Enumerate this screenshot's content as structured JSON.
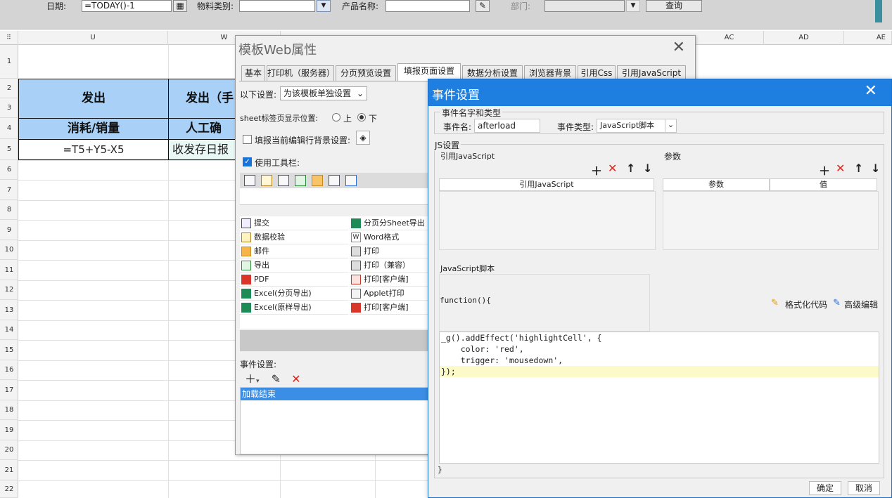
{
  "filter_bar": {
    "date_label": "日期:",
    "date_value": "=TODAY()-1",
    "material_label": "物料类别:",
    "product_label": "产品名称:",
    "dept_label": "部门:",
    "query_button": "查询"
  },
  "sheet": {
    "columns": [
      "U",
      "W",
      "AC",
      "AD",
      "AE"
    ],
    "rows": [
      "1",
      "2",
      "3",
      "4",
      "5",
      "6",
      "7",
      "8",
      "9",
      "10",
      "11",
      "12",
      "13",
      "14",
      "15",
      "16",
      "17",
      "18",
      "19",
      "20",
      "21",
      "22"
    ],
    "header_cell_1": "发出",
    "header_cell_2": "发出（手",
    "sub_header_1": "消耗/销量",
    "sub_header_2": "人工确",
    "formula_cell": "=T5+Y5-X5",
    "text_cell": "收发存日报"
  },
  "back_dialog": {
    "title": "模板Web属性",
    "tabs": [
      "基本",
      "打印机（服务器）",
      "分页预览设置",
      "填报页面设置",
      "数据分析设置",
      "浏览器背景",
      "引用Css",
      "引用JavaScript"
    ],
    "active_tab_index": 3,
    "setting_label": "以下设置:",
    "setting_value": "为该模板单独设置",
    "sheet_tab_label": "sheet标签页显示位置:",
    "radio_top": "上",
    "radio_bottom": "下",
    "row_bg_label": "填报当前编辑行背景设置:",
    "toolbar_label": "使用工具栏:",
    "buttons_left": [
      "提交",
      "数据校验",
      "邮件",
      "导出",
      "PDF",
      "Excel(分页导出)",
      "Excel(原样导出)"
    ],
    "buttons_right": [
      "分页分Sheet导出",
      "Word格式",
      "打印",
      "打印（兼容）",
      "打印[客户端]",
      "Applet打印",
      "打印[客户端]"
    ],
    "event_settings_label": "事件设置:",
    "event_item": "加载结束"
  },
  "front_dialog": {
    "title": "事件设置",
    "name_type_group": "事件名字和类型",
    "event_name_label": "事件名:",
    "event_name_value": "afterload",
    "event_type_label": "事件类型:",
    "event_type_value": "JavaScript脚本",
    "js_group": "JS设置",
    "ref_js_label": "引用JavaScript",
    "params_label": "参数",
    "ref_js_column": "引用JavaScript",
    "param_column": "参数",
    "value_column": "值",
    "script_label": "JavaScript脚本",
    "function_header": "function(){",
    "format_code": "格式化代码",
    "advanced_edit": "高级编辑",
    "code_lines": [
      "_g().addEffect('highlightCell', {",
      "    color: 'red',",
      "    trigger: 'mousedown',",
      "});"
    ],
    "closing_brace": "}",
    "ok_button": "确定",
    "cancel_button": "取消"
  }
}
